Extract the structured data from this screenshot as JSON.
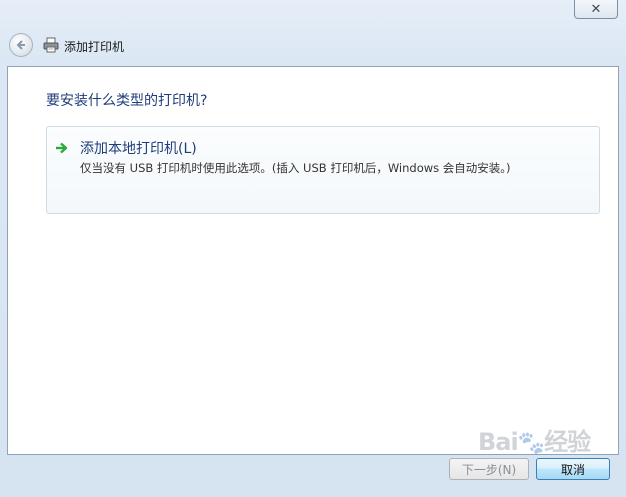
{
  "window": {
    "title": "添加打印机",
    "close_label": "✕"
  },
  "content": {
    "heading": "要安装什么类型的打印机?",
    "options": [
      {
        "title": "添加本地打印机(L)",
        "description": "仅当没有 USB 打印机时使用此选项。(插入 USB 打印机后，Windows 会自动安装。)"
      }
    ]
  },
  "buttons": {
    "next_label": "下一步(N)",
    "cancel_label": "取消"
  },
  "watermark": {
    "text": "Bai",
    "text2": "经验"
  },
  "colors": {
    "heading": "#1f3d7a",
    "arrow": "#2ea836",
    "cancel_border": "#3c7fb1"
  }
}
